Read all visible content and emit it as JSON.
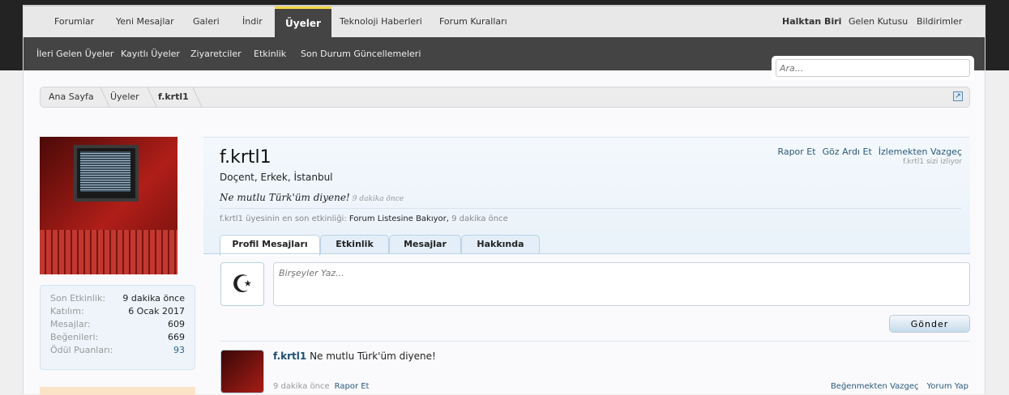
{
  "nav": {
    "tabs": [
      "Forumlar",
      "Yeni Mesajlar",
      "Galeri",
      "İndir",
      "Üyeler",
      "Teknoloji Haberleri",
      "Forum Kuralları"
    ],
    "user": "Halktan Biri",
    "inbox": "Gelen Kutusu",
    "alerts": "Bildirimler"
  },
  "subnav": [
    "İleri Gelen Üyeler",
    "Kayıtlı Üyeler",
    "Ziyaretciler",
    "Etkinlik",
    "Son Durum Güncellemeleri"
  ],
  "search": {
    "placeholder": "Ara..."
  },
  "breadcrumb": [
    "Ana Sayfa",
    "Üyeler",
    "f.krtl1"
  ],
  "stats": [
    {
      "k": "Son Etkinlik:",
      "v": "9 dakika önce"
    },
    {
      "k": "Katılım:",
      "v": "6 Ocak 2017"
    },
    {
      "k": "Mesajlar:",
      "v": "609"
    },
    {
      "k": "Beğenileri:",
      "v": "669"
    },
    {
      "k": "Ödül Puanları:",
      "v": "93"
    }
  ],
  "profile": {
    "name": "f.krtl1",
    "title": "Doçent, Erkek, İstanbul",
    "status": "Ne mutlu Türk'üm diyene!",
    "status_time": "9 dakika önce",
    "last_prefix": "f.krtl1 üyesinin en son etkinliği:",
    "last_activity": "Forum Listesine Bakıyor,",
    "last_time": "9 dakika önce"
  },
  "actions": {
    "report": "Rapor Et",
    "ignore": "Göz Ardı Et",
    "unwatch": "İzlemekten Vazgeç",
    "watching": "f.krtl1 sizi izliyor"
  },
  "tabs": [
    "Profil Mesajları",
    "Etkinlik",
    "Mesajlar",
    "Hakkında"
  ],
  "composer": {
    "placeholder": "Birşeyler Yaz...",
    "send": "Gönder"
  },
  "post": {
    "author": "f.krtl1",
    "text": "Ne mutlu Türk'üm diyene!",
    "time": "9 dakika önce",
    "report": "Rapor Et",
    "unlike": "Beğenmekten Vazgeç",
    "comment": "Yorum Yap"
  },
  "colors": {
    "accent": "#f5d742",
    "link": "#2a5a7a"
  }
}
